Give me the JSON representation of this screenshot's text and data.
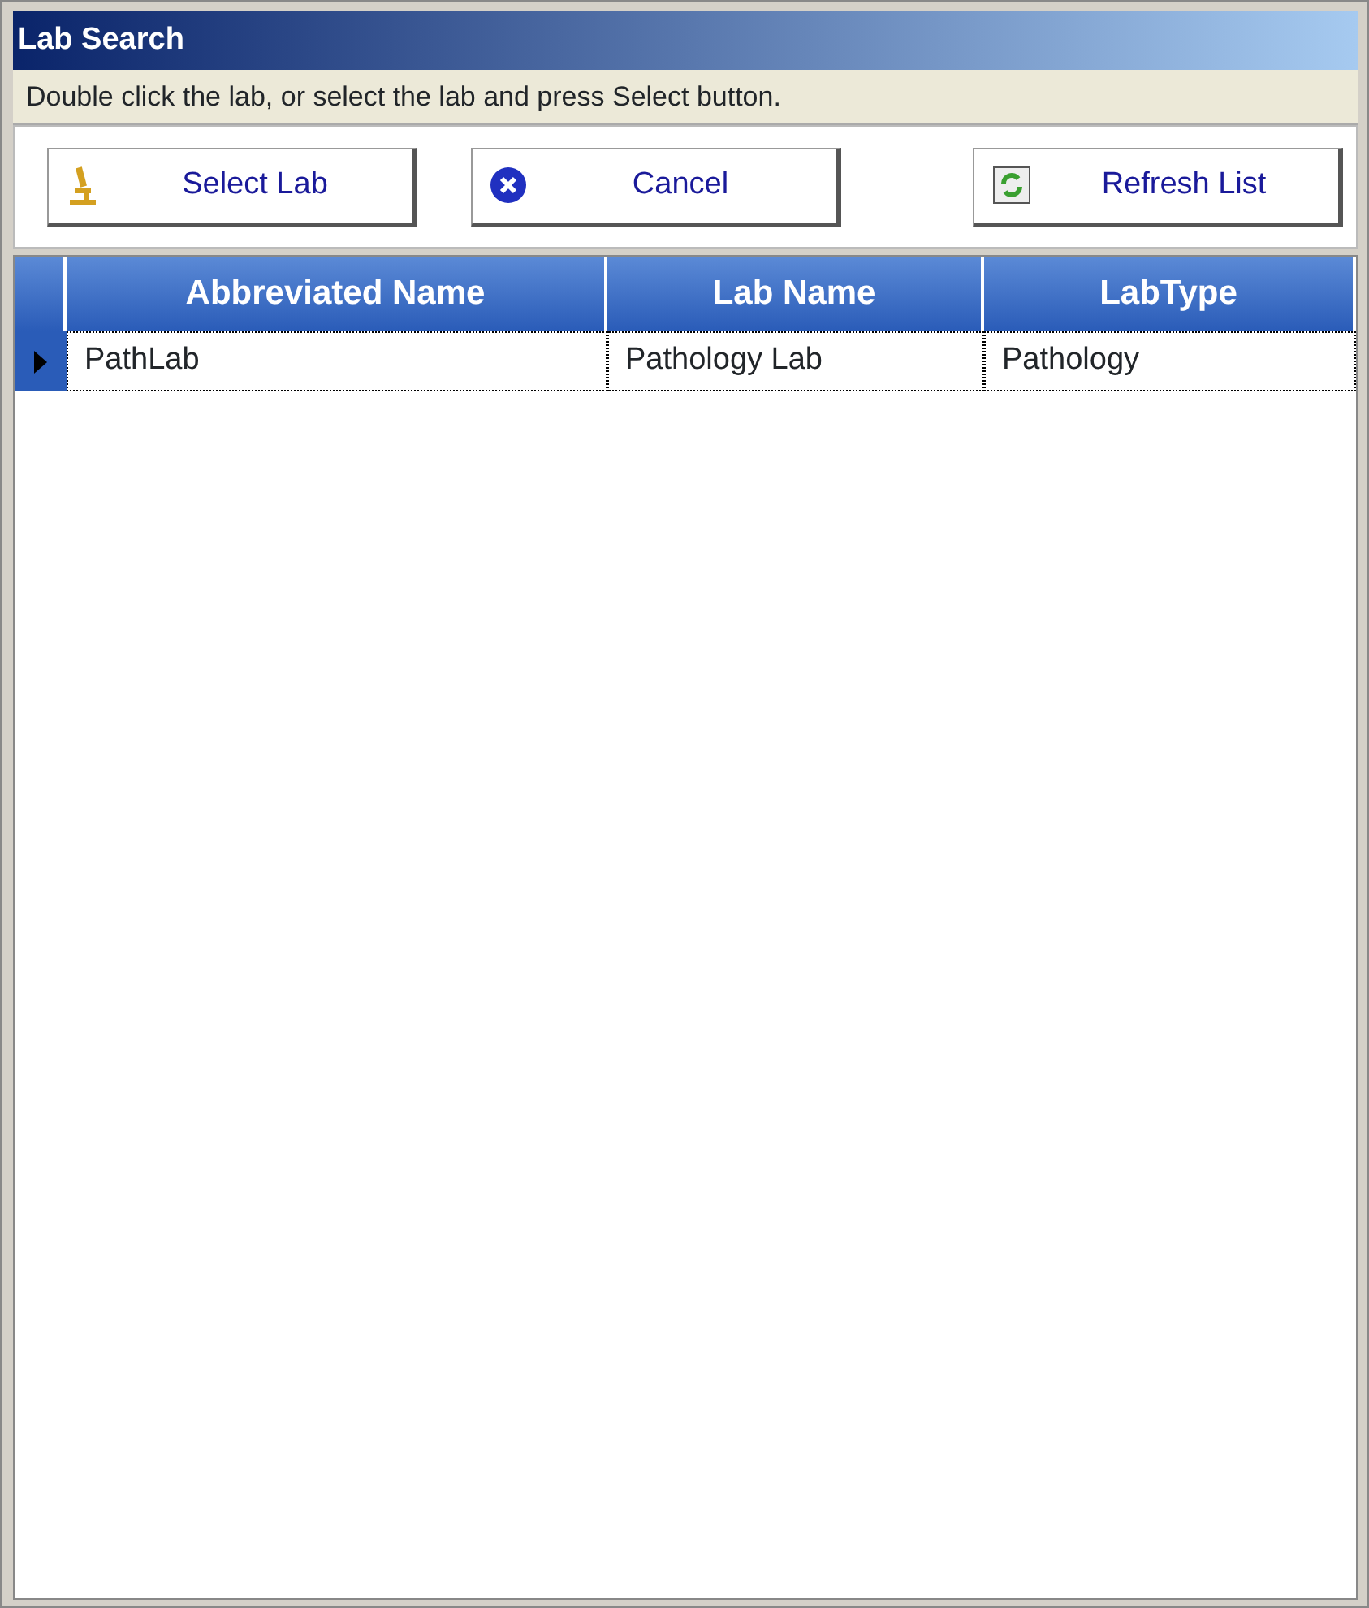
{
  "window": {
    "title": "Lab Search"
  },
  "instruction": "Double click the lab, or select the lab and press Select button.",
  "buttons": [
    {
      "label": "Select Lab",
      "kind": "microscope"
    },
    {
      "label": "Cancel",
      "kind": "cancel"
    },
    {
      "label": "Refresh List",
      "kind": "refresh"
    }
  ],
  "table": {
    "columns": [
      "Abbreviated Name",
      "Lab Name",
      "LabType"
    ],
    "rows": [
      {
        "cells": [
          "PathLab",
          "Pathology Lab",
          "Pathology"
        ],
        "selected": true
      }
    ]
  }
}
